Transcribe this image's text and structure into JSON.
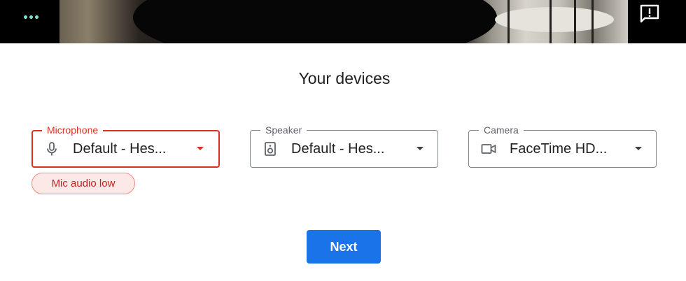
{
  "app": {
    "title": "Your devices"
  },
  "toolbar": {
    "more_icon": "more-dots-icon",
    "feedback_icon": "feedback-icon"
  },
  "devices": {
    "microphone": {
      "label": "Microphone",
      "value": "Default - Hes...",
      "icon": "microphone-icon",
      "state": "error"
    },
    "speaker": {
      "label": "Speaker",
      "value": "Default - Hes...",
      "icon": "speaker-icon"
    },
    "camera": {
      "label": "Camera",
      "value": "FaceTime HD...",
      "icon": "video-camera-icon"
    }
  },
  "warning": {
    "text": "Mic audio low"
  },
  "actions": {
    "next_label": "Next"
  },
  "colors": {
    "accent": "#1a73e8",
    "error": "#d93025",
    "chip_bg": "#fce8e6",
    "dots": "#7ee2d3"
  }
}
